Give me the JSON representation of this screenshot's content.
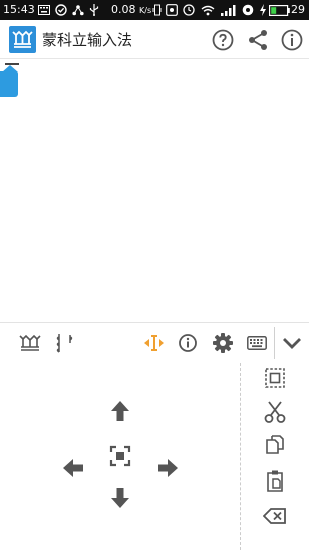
{
  "status_bar": {
    "time": "15:43",
    "speed": "0.08",
    "speed_unit": "K/s",
    "battery": "29"
  },
  "app_bar": {
    "title": "蒙科立输入法",
    "icons": [
      "app-logo",
      "help-icon",
      "share-icon",
      "info-icon"
    ]
  },
  "toolbar": {
    "items": [
      "mongolian-script-logo",
      "mongolian-text",
      "cursor-move",
      "info",
      "settings",
      "keyboard",
      "collapse"
    ],
    "accent_color": "#f0a030"
  },
  "edit_panel": {
    "arrows": [
      "up",
      "left",
      "select-center",
      "right",
      "down"
    ],
    "side_actions": [
      "select-all",
      "cut",
      "copy",
      "paste",
      "delete"
    ]
  },
  "colors": {
    "primary": "#2c8fd9",
    "icon_gray": "#555555",
    "status_bg": "#111111"
  }
}
